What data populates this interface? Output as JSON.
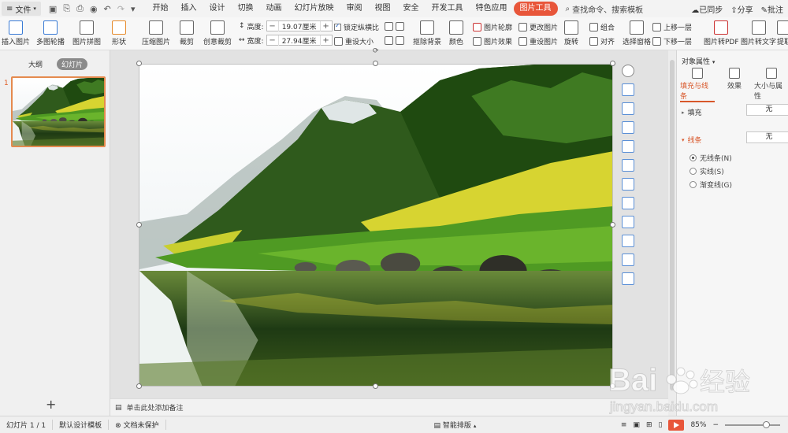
{
  "menubar": {
    "file_label": "文件",
    "tabs": [
      "开始",
      "插入",
      "设计",
      "切换",
      "动画",
      "幻灯片放映",
      "审阅",
      "视图",
      "安全",
      "开发工具",
      "特色应用",
      "图片工具"
    ],
    "active_tab": "图片工具",
    "search_label": "查找命令、搜索模板",
    "sync_label": "已同步",
    "share_label": "分享",
    "comment_label": "批注"
  },
  "toolbar": {
    "insert_image": "插入图片",
    "multi_carousel": "多图轮播",
    "image_collage": "图片拼图",
    "shape": "形状",
    "compress": "压缩图片",
    "crop": "裁剪",
    "creative_crop": "创意裁剪",
    "height_label": "高度:",
    "height_value": "19.07厘米",
    "width_label": "宽度:",
    "width_value": "27.94厘米",
    "lock_ratio": "锁定纵横比",
    "reset_size": "重设大小",
    "remove_bg": "抠除背景",
    "color": "颜色",
    "outline": "图片轮廓",
    "effects": "图片效果",
    "change_image": "更改图片",
    "reset_image": "重设图片",
    "rotate": "旋转",
    "group": "组合",
    "align": "对齐",
    "selection_pane": "选择窗格",
    "bring_forward": "上移一层",
    "send_backward": "下移一层",
    "to_pdf": "图片转PDF",
    "to_text": "图片转文字",
    "extract": "提取"
  },
  "leftpanel": {
    "tab_outline": "大纲",
    "tab_slides": "幻灯片",
    "slide_number": "1",
    "add_slide": "+"
  },
  "notes_placeholder": "单击此处添加备注",
  "rightpanel": {
    "title": "对象属性",
    "tabs": [
      "填充与线条",
      "效果",
      "大小与属性"
    ],
    "fill_label": "填充",
    "fill_value": "无",
    "line_label": "线条",
    "line_value": "无",
    "line_options": [
      "无线条(N)",
      "实线(S)",
      "渐变线(G)"
    ]
  },
  "statusbar": {
    "slide_info": "幻灯片 1 / 1",
    "template": "默认设计模板",
    "protect": "文档未保护",
    "smart_layout": "智能排版",
    "zoom": "85%"
  },
  "watermark": {
    "brand": "Bai",
    "brand2": "经验",
    "url": "jingyan.baidu.com"
  }
}
